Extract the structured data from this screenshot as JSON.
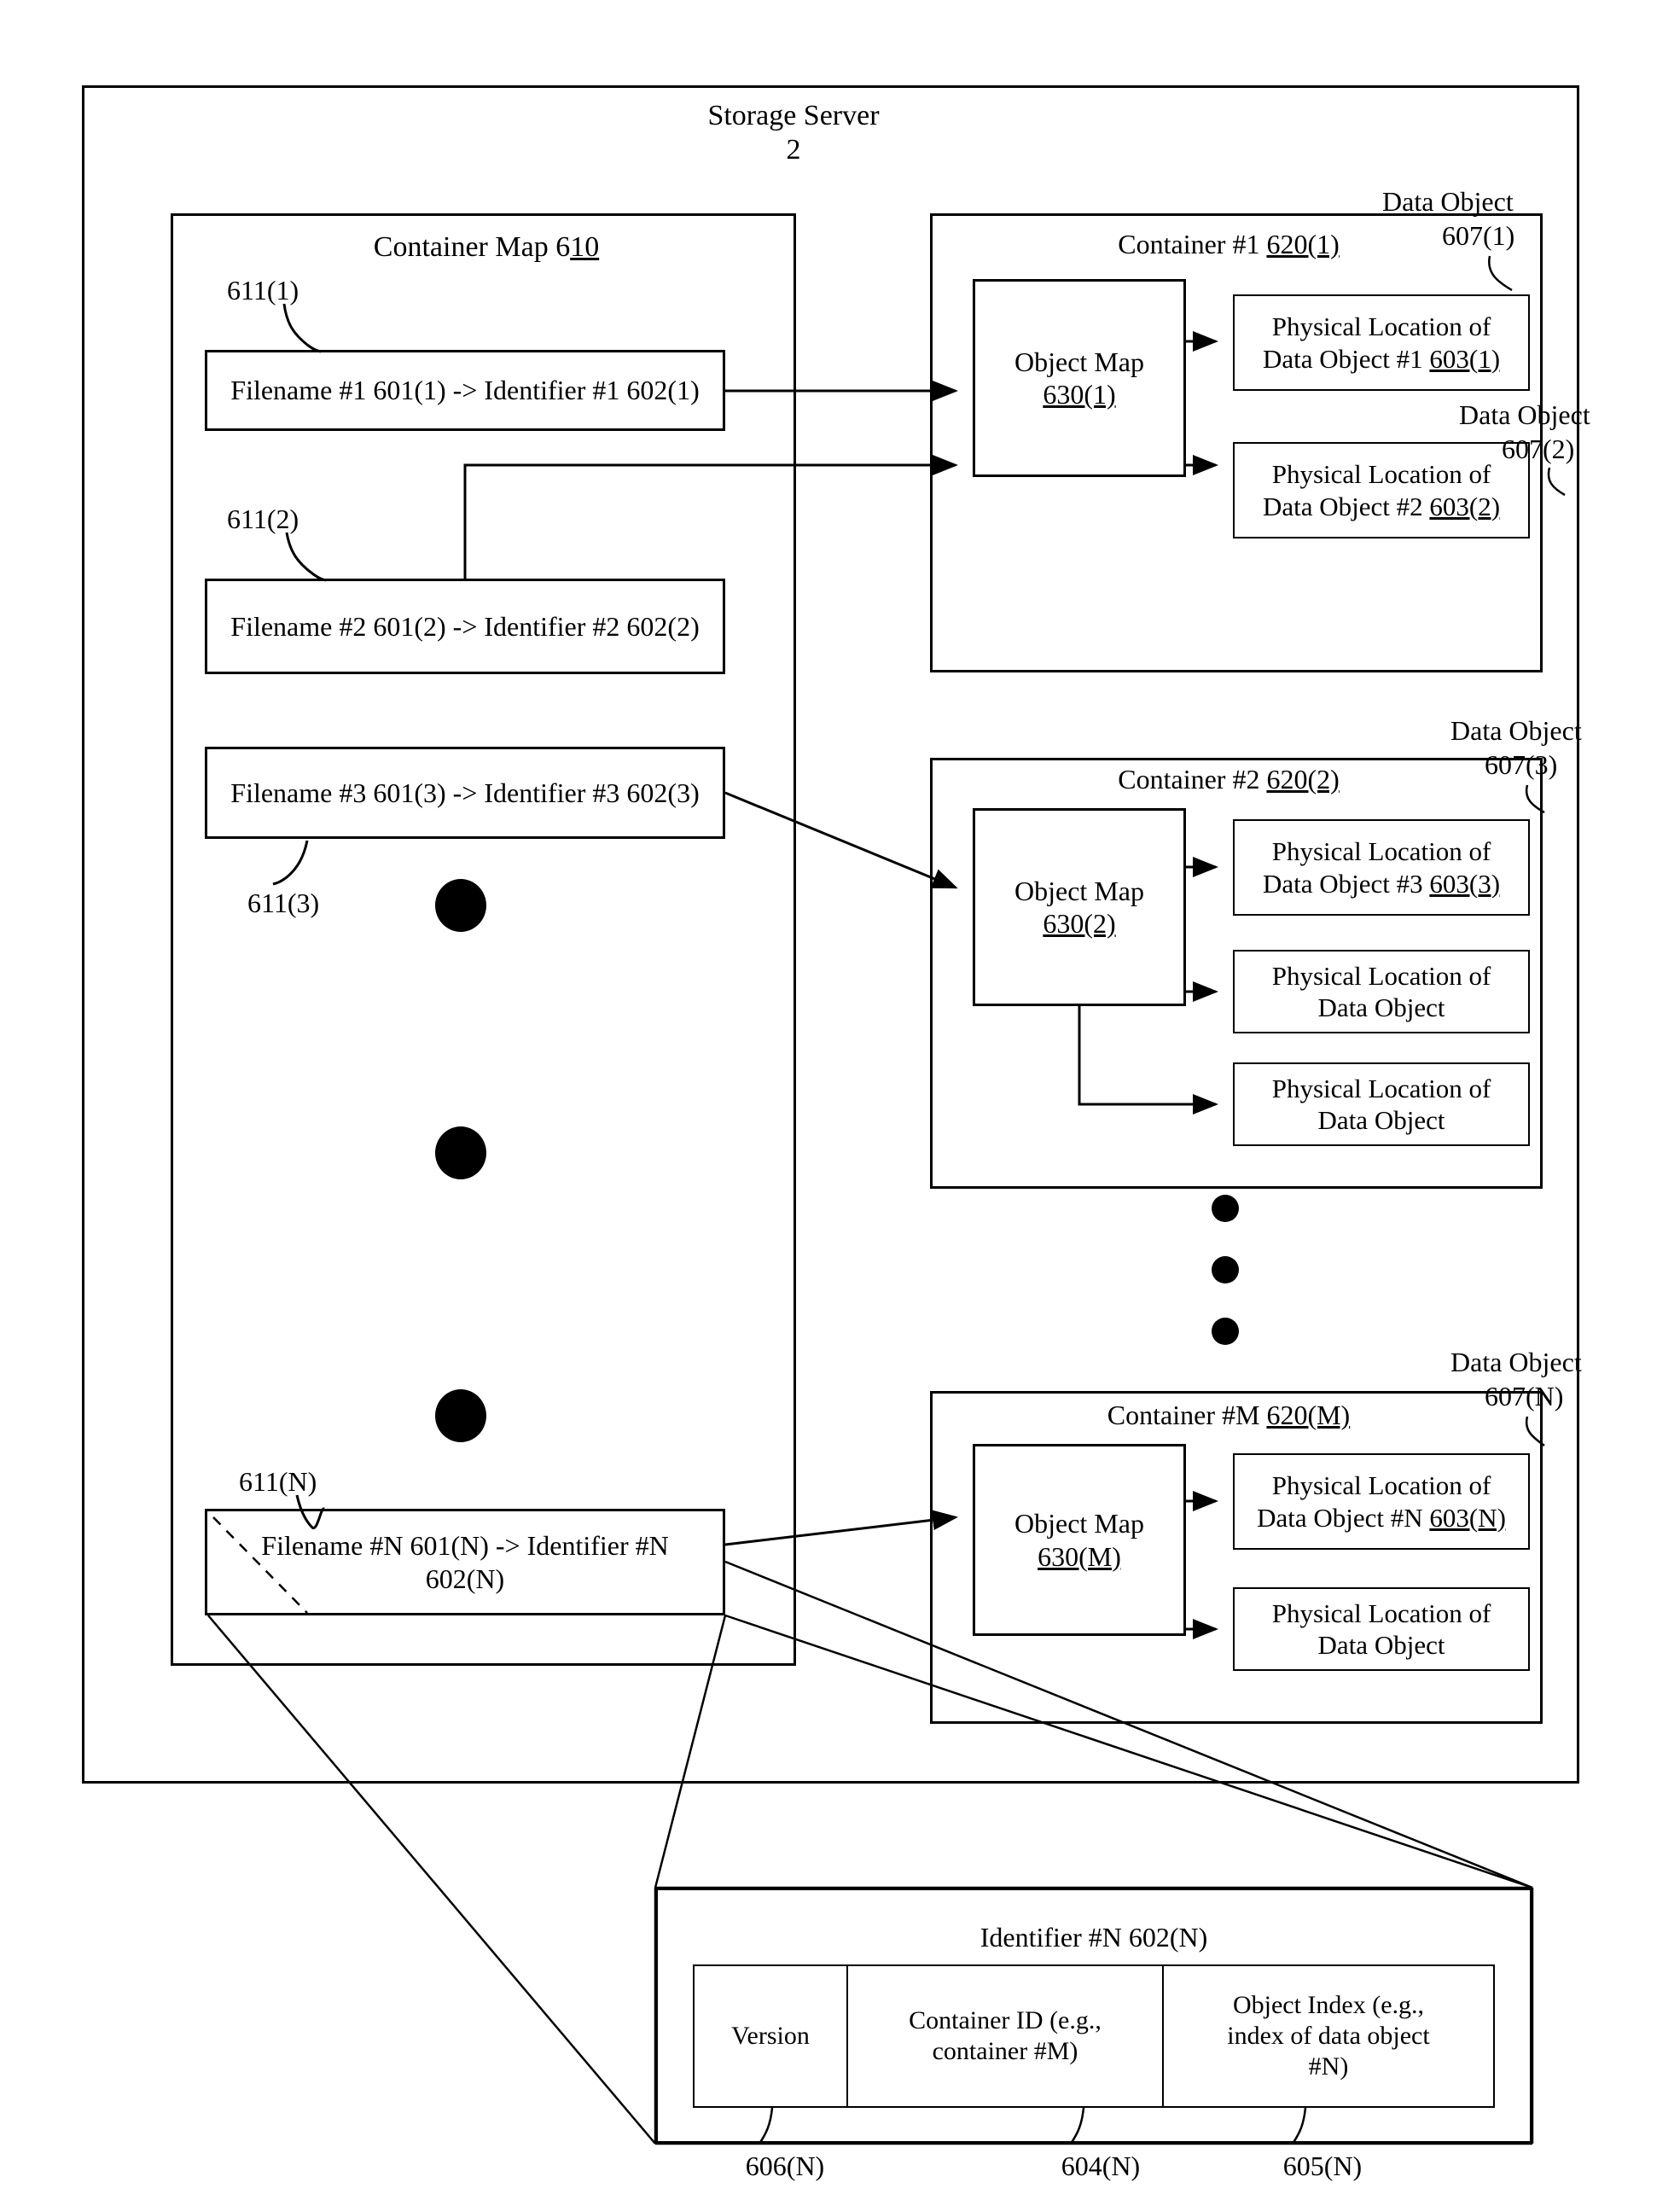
{
  "figure": {
    "outer_title_line1": "Storage Server",
    "outer_title_line2": "2"
  },
  "container_map": {
    "title_prefix": "Container Map 6",
    "title_underlined": "10",
    "entries": [
      {
        "ref": "611(1)",
        "text": "Filename #1 601(1) -> Identifier #1 602(1)"
      },
      {
        "ref": "611(2)",
        "text": "Filename #2  601(2) -> Identifier #2 602(2)"
      },
      {
        "ref": "611(3)",
        "text": "Filename #3 601(3) -> Identifier #3 602(3)"
      },
      {
        "ref": "611(N)",
        "text_line1": "Filename #N 601(N) -> Identifier #N",
        "text_line2": "602(N)"
      }
    ]
  },
  "containers": [
    {
      "title_prefix": "Container #1 ",
      "title_underlined": "620(1)",
      "object_map_line1": "Object Map",
      "object_map_line2": "630(1)",
      "locations": [
        {
          "line1": "Physical Location of",
          "line2_prefix": "Data Object #1 ",
          "line2_underlined": "603(1)"
        },
        {
          "line1": "Physical Location of",
          "line2_prefix": "Data Object #2 ",
          "line2_underlined": "603(2)"
        }
      ]
    },
    {
      "title_prefix": "Container #2 ",
      "title_underlined": "620(2)",
      "object_map_line1": "Object Map",
      "object_map_line2": "630(2)",
      "locations": [
        {
          "line1": "Physical Location of",
          "line2_prefix": "Data Object #3 ",
          "line2_underlined": "603(3)"
        },
        {
          "line1": "Physical Location of",
          "line2_prefix": "Data Object",
          "line2_underlined": ""
        },
        {
          "line1": "Physical Location of",
          "line2_prefix": "Data Object",
          "line2_underlined": ""
        }
      ]
    },
    {
      "title_prefix": "Container #M ",
      "title_underlined": "620(M)",
      "object_map_line1": "Object Map",
      "object_map_line2": "630(M)",
      "locations": [
        {
          "line1": "Physical Location of",
          "line2_prefix": "Data Object #N ",
          "line2_underlined": "603(N)"
        },
        {
          "line1": "Physical Location of",
          "line2_prefix": "Data Object",
          "line2_underlined": ""
        }
      ]
    }
  ],
  "data_object_callouts": [
    {
      "label": "Data Object",
      "ref": "607(1)"
    },
    {
      "label": "Data Object",
      "ref": "607(2)"
    },
    {
      "label": "Data Object",
      "ref": "607(3)"
    },
    {
      "label": "Data Object",
      "ref": "607(N)"
    }
  ],
  "identifier_detail": {
    "title": "Identifier #N 602(N)",
    "fields": [
      {
        "lines": [
          "Version"
        ],
        "ref": "606(N)"
      },
      {
        "lines": [
          "Container ID (e.g.,",
          "container #M)"
        ],
        "ref": "604(N)"
      },
      {
        "lines": [
          "Object Index (e.g.,",
          "index of data object",
          "#N)"
        ],
        "ref": "605(N)"
      }
    ]
  }
}
